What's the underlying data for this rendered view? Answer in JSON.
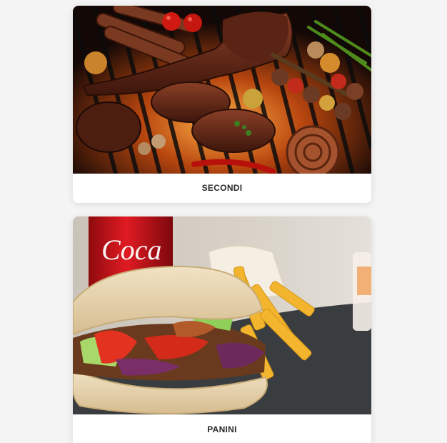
{
  "menu": {
    "categories": [
      {
        "label": "SECONDI",
        "image_alt": "Grigliata mista di carne"
      },
      {
        "label": "PANINI",
        "image_alt": "Panino kebab con patatine e cola"
      }
    ]
  }
}
